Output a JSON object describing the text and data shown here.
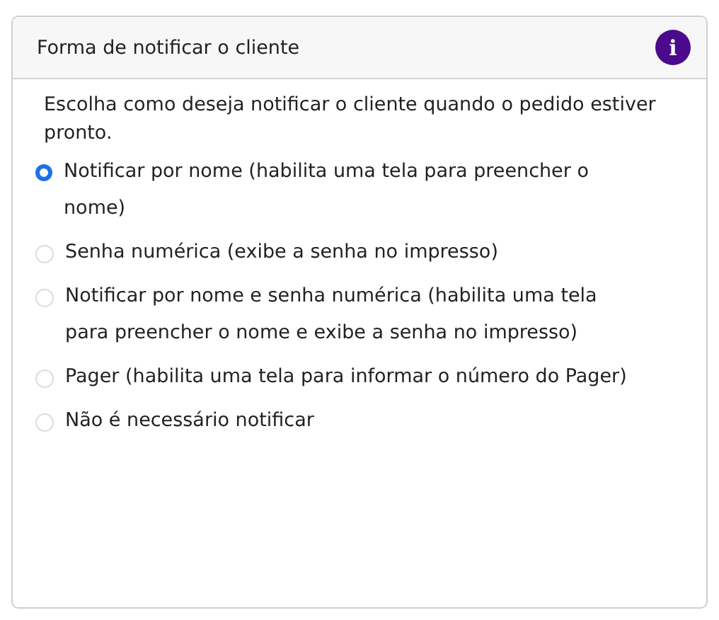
{
  "card": {
    "title": "Forma de notificar o cliente",
    "info_icon": "i"
  },
  "description": "Escolha como deseja notificar o cliente quando o pedido estiver pronto.",
  "options": [
    {
      "label": "Notificar por nome (habilita uma tela para preencher o nome)",
      "selected": true
    },
    {
      "label": "Senha numérica (exibe a senha no impresso)",
      "selected": false
    },
    {
      "label": "Notificar por nome e senha numérica (habilita uma tela para preencher o nome e exibe a senha no impresso)",
      "selected": false
    },
    {
      "label": "Pager (habilita uma tela para informar o número do Pager)",
      "selected": false
    },
    {
      "label": "Não é necessário notificar",
      "selected": false
    }
  ]
}
